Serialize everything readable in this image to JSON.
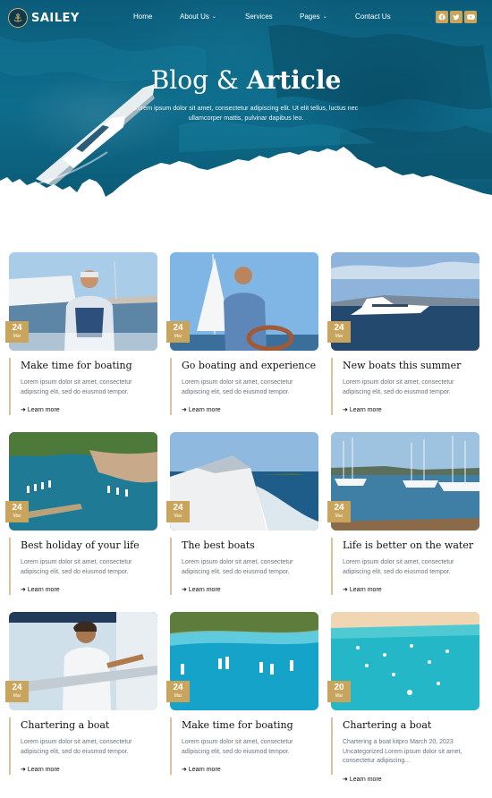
{
  "brand": {
    "name": "SAILEY"
  },
  "nav": {
    "items": [
      {
        "label": "Home",
        "has_dropdown": false
      },
      {
        "label": "About Us",
        "has_dropdown": true
      },
      {
        "label": "Services",
        "has_dropdown": false
      },
      {
        "label": "Pages",
        "has_dropdown": true
      },
      {
        "label": "Contact Us",
        "has_dropdown": false
      }
    ],
    "social": [
      "facebook-icon",
      "twitter-icon",
      "youtube-icon"
    ]
  },
  "hero": {
    "title_part1": "Blog",
    "title_amp": "&",
    "title_part2": "Article",
    "subtitle": "Lorem ipsum dolor sit amet, consectetur adipiscing elit. Ut elit tellus, luctus nec ullamcorper mattis, pulvinar dapibus leo."
  },
  "colors": {
    "accent": "#c9a45c",
    "hero": "#0e6d8c",
    "accent_line": "#d9c39a"
  },
  "posts": [
    {
      "title": "Make time for boating",
      "day": "24",
      "month": "Mar",
      "excerpt": "Lorem ipsum dolor sit amet, consectetur adipiscing elit, sed do eiusmod tempor.",
      "more": "Learn more",
      "image": "man-on-boat-deck"
    },
    {
      "title": "Go boating and experience",
      "day": "24",
      "month": "Mar",
      "excerpt": "Lorem ipsum dolor sit amet, consectetur adipiscing elit, sed do eiusmod tempor.",
      "more": "Learn more",
      "image": "man-at-helm-sailboat"
    },
    {
      "title": "New boats this summer",
      "day": "24",
      "month": "Mar",
      "excerpt": "Lorem ipsum dolor sit amet, consectetur adipiscing elit, sed do eiusmod tempor.",
      "more": "Learn more",
      "image": "yacht-at-sea"
    },
    {
      "title": "Best holiday of your life",
      "day": "24",
      "month": "Mar",
      "excerpt": "Lorem ipsum dolor sit amet, consectetur adipiscing elit, sed do eiusmod tempor.",
      "more": "Learn more",
      "image": "harbor-aerial"
    },
    {
      "title": "The best boats",
      "day": "24",
      "month": "Mar",
      "excerpt": "Lorem ipsum dolor sit amet, consectetur adipiscing elit, sed do eiusmod tempor.",
      "more": "Learn more",
      "image": "speedboat-bow"
    },
    {
      "title": "Life is better on the water",
      "day": "24",
      "month": "Mar",
      "excerpt": "Lorem ipsum dolor sit amet, consectetur adipiscing elit, sed do eiusmod tempor.",
      "more": "Learn more",
      "image": "marina-dock"
    },
    {
      "title": "Chartering a boat",
      "day": "24",
      "month": "Mar",
      "excerpt": "Lorem ipsum dolor sit amet, consectetur adipiscing elit, sed do eiusmod tempor.",
      "more": "Learn more",
      "image": "man-sitting-on-yacht"
    },
    {
      "title": "Make time for boating",
      "day": "24",
      "month": "Mar",
      "excerpt": "Lorem ipsum dolor sit amet, consectetur adipiscing elit, sed do eiusmod tempor.",
      "more": "Learn more",
      "image": "boats-turquoise-bay"
    },
    {
      "title": "Chartering a boat",
      "day": "20",
      "month": "Mar",
      "excerpt": "Chartering a boat kitpro March 20, 2023 Uncategorized Lorem ipsum dolor sit amet, consectetur adipiscing...",
      "more": "Learn more",
      "image": "boats-lagoon-aerial"
    }
  ]
}
